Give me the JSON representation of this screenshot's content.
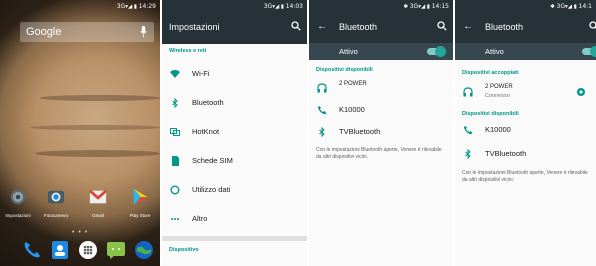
{
  "home": {
    "status": {
      "network": "3G",
      "time": "14:29"
    },
    "search_label": "Google",
    "apps": [
      {
        "label": "Impostazioni",
        "icon": "gear-icon"
      },
      {
        "label": "Fotocamera",
        "icon": "camera-icon"
      },
      {
        "label": "Gmail",
        "icon": "gmail-icon"
      },
      {
        "label": "Play Store",
        "icon": "play-store-icon"
      }
    ],
    "dock": [
      "phone-icon",
      "contacts-icon",
      "app-drawer-icon",
      "messages-icon",
      "browser-icon"
    ]
  },
  "settings": {
    "status": {
      "network": "3G",
      "time": "14:03"
    },
    "title": "Impostazioni",
    "section": "Wireless e reti",
    "items": [
      {
        "label": "Wi-Fi",
        "icon": "wifi-icon"
      },
      {
        "label": "Bluetooth",
        "icon": "bluetooth-icon"
      },
      {
        "label": "HotKnot",
        "icon": "hotknot-icon"
      },
      {
        "label": "Schede SIM",
        "icon": "sim-card-icon"
      },
      {
        "label": "Utilizzo dati",
        "icon": "data-usage-icon"
      },
      {
        "label": "Altro",
        "icon": "more-icon"
      }
    ],
    "section2": "Dispositivo"
  },
  "bt1": {
    "status": {
      "network": "3G",
      "time": "14:15"
    },
    "title": "Bluetooth",
    "toggle_label": "Attivo",
    "section": "Dispositivi disponibili",
    "devices": [
      {
        "name": "2 POWER",
        "icon": "headphones-icon"
      },
      {
        "name": "K10000",
        "icon": "phone-icon"
      },
      {
        "name": "TVBluetooth",
        "icon": "bluetooth-icon"
      }
    ],
    "info": "Con le impostazioni Bluetooth aperte, Venere è rilevabile da altri dispositivi vicini."
  },
  "bt2": {
    "status": {
      "network": "3G",
      "time": "14:1"
    },
    "title": "Bluetooth",
    "toggle_label": "Attivo",
    "paired_section": "Dispositivi accoppiati",
    "paired": {
      "name": "2 POWER",
      "status": "Connesso"
    },
    "section": "Dispositivi disponibili",
    "devices": [
      {
        "name": "K10000",
        "icon": "phone-icon"
      },
      {
        "name": "TVBluetooth",
        "icon": "bluetooth-icon"
      }
    ],
    "info": "Con le impostazioni Bluetooth aperte, Venere è rilevabile da altri dispositivi vicini."
  },
  "colors": {
    "appbar": "#263238",
    "accent": "#009688",
    "icon": "#009688"
  }
}
